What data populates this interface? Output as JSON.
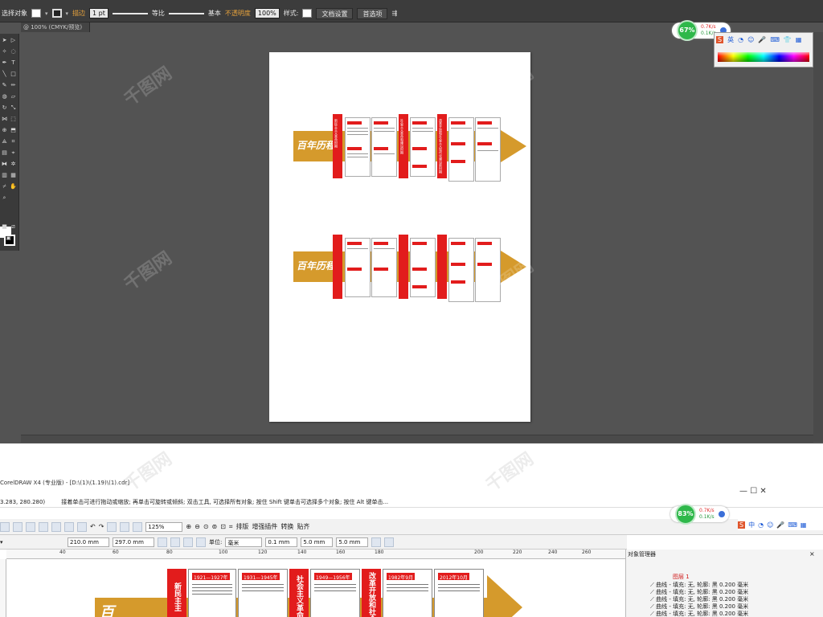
{
  "illustrator": {
    "control_bar": {
      "selection_label": "选择对象",
      "stroke_label": "描边",
      "stroke_weight": "1 pt",
      "stroke_profile": "等比",
      "brush_label": "基本",
      "opacity_label": "不透明度",
      "opacity_value": "100%",
      "style_label": "样式:",
      "doc_settings_button": "文档设置",
      "preferences_button": "首选项"
    },
    "doc_tab": "@ 100% (CMYK/预览)",
    "artwork": {
      "banner_title": "百年历程",
      "column_titles": [
        "新民主主义革命时期",
        "社会主义革命和建设时期",
        "改革开放和社会主义现代化建设新时期"
      ],
      "date_tags": [
        "1921—1927年",
        "1931—1945年",
        "1949—1956年",
        "1982年9月",
        "2012年10月"
      ]
    },
    "gauge": {
      "percent": "67%",
      "up": "0.7K/s",
      "down": "0.1K/s"
    },
    "ime": {
      "brand": "S",
      "lang": "英"
    }
  },
  "corel": {
    "title": "CorelDRAW X4 (专业版) - [D:\\(1)\\(1.19)\\(1).cdr]",
    "status_coords": "3.283, 280.280)",
    "status_hint": "接着单击可进行拖动或缩放; 再单击可旋转或倾斜; 双击工具, 可选择所有对象; 按住 Shift 键单击可选择多个对象; 按住 Alt 键单击...",
    "zoom": "125%",
    "toolbar_buttons": [
      "排版",
      "增强插件",
      "转换",
      "贴齐"
    ],
    "width": "210.0 mm",
    "height": "297.0 mm",
    "units_label": "单位:",
    "units_value": "毫米",
    "nudge": "0.1 mm",
    "dup_x": "5.0 mm",
    "dup_y": "5.0 mm",
    "ruler_ticks": [
      "40",
      "60",
      "80",
      "100",
      "120",
      "140",
      "160",
      "180",
      "200",
      "220",
      "240",
      "260"
    ],
    "gauge": {
      "percent": "83%",
      "up": "0.7K/s",
      "down": "0.1K/s"
    },
    "ime": {
      "lang": "中"
    },
    "object_manager": {
      "title": "对象管理器",
      "layer": "图层 1",
      "items": [
        "曲线 - 填充: 无, 轮廓: 黑  0.200 毫米",
        "曲线 - 填充: 无, 轮廓: 黑  0.200 毫米",
        "曲线 - 填充: 无, 轮廓: 黑  0.200 毫米",
        "曲线 - 填充: 无, 轮廓: 黑  0.200 毫米",
        "曲线 - 填充: 无, 轮廓: 黑  0.200 毫米"
      ]
    },
    "canvas": {
      "date_tags": [
        "1921—1927年",
        "1931—1945年",
        "1949—1956年",
        "1982年9月",
        "2012年10月"
      ],
      "red_columns": [
        "新民主主",
        "社会主义革命",
        "改革开放和社会主"
      ],
      "banner_initial": "百"
    }
  },
  "colors": {
    "accent_gold": "#d59a2c",
    "accent_red": "#e21c1c",
    "ai_bg": "#535353"
  }
}
